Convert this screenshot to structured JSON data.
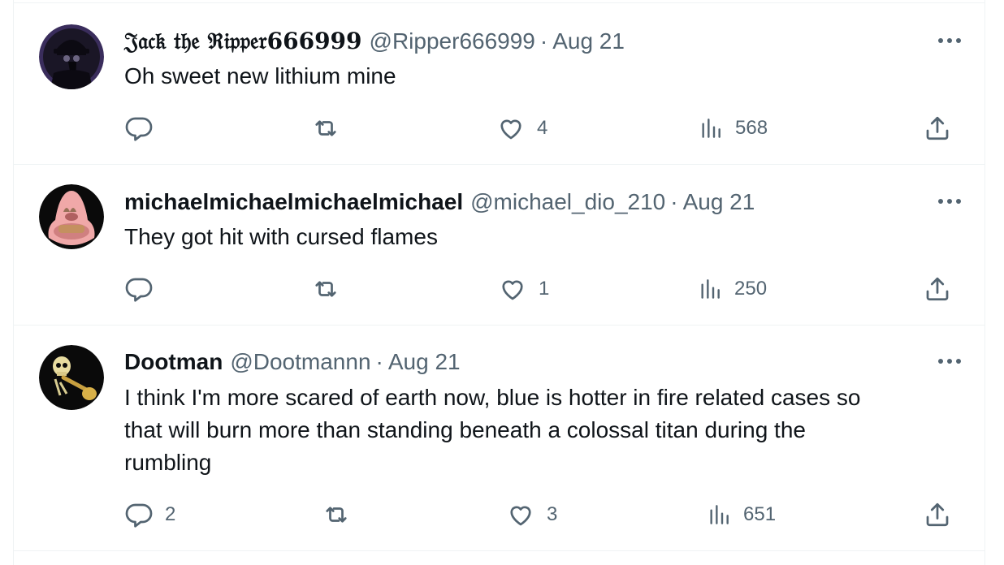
{
  "tweets": [
    {
      "name": "𝔍𝔞𝔠𝔨 𝔱𝔥𝔢 ℜ𝔦𝔭𝔭𝔢𝔯666999",
      "handle": "@Ripper666999",
      "separator": "·",
      "date": "Aug 21",
      "text": "Oh sweet new lithium mine",
      "replies": "",
      "retweets": "",
      "likes": "4",
      "views": "568",
      "avatar_icon": "plague-doctor-avatar"
    },
    {
      "name": "michaelmichaelmichaelmichael",
      "handle": "@michael_dio_210",
      "separator": "·",
      "date": "Aug 21",
      "text": "They got hit with cursed flames",
      "replies": "",
      "retweets": "",
      "likes": "1",
      "views": "250",
      "avatar_icon": "patrick-star-avatar"
    },
    {
      "name": "Dootman",
      "handle": "@Dootmannn",
      "separator": "·",
      "date": "Aug 21",
      "text_lines": [
        "I think I'm more scared of earth now, blue is hotter in fire related cases so",
        "that will burn more than standing beneath a colossal titan during the",
        "rumbling"
      ],
      "replies": "2",
      "retweets": "",
      "likes": "3",
      "views": "651",
      "avatar_icon": "skeleton-trumpet-avatar"
    }
  ],
  "icons": {
    "reply": "reply-icon",
    "retweet": "retweet-icon",
    "like": "heart-icon",
    "views": "views-icon",
    "share": "share-icon",
    "more": "more-icon"
  },
  "colors": {
    "text": "#0f1419",
    "secondary": "#536471",
    "divider": "#eff3f4"
  }
}
